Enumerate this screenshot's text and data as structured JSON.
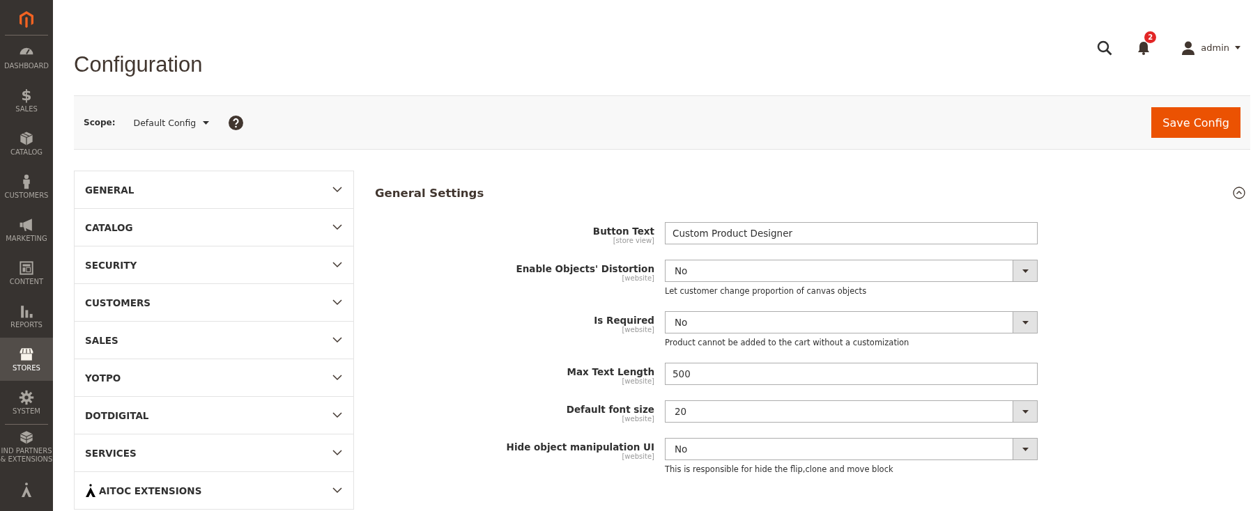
{
  "sidebar": {
    "items": [
      {
        "label": "DASHBOARD",
        "kind": "gauge",
        "selected": false
      },
      {
        "label": "SALES",
        "kind": "glyph",
        "glyph": "$",
        "selected": false
      },
      {
        "label": "CATALOG",
        "kind": "box",
        "selected": false
      },
      {
        "label": "CUSTOMERS",
        "kind": "person",
        "selected": false
      },
      {
        "label": "MARKETING",
        "kind": "megaphone",
        "selected": false
      },
      {
        "label": "CONTENT",
        "kind": "layout",
        "selected": false
      },
      {
        "label": "REPORTS",
        "kind": "bars",
        "selected": false
      },
      {
        "label": "STORES",
        "kind": "store",
        "selected": true
      },
      {
        "label": "SYSTEM",
        "kind": "gear",
        "selected": false
      },
      {
        "label": "IND PARTNERS",
        "label_2": "& EXTENSIONS",
        "kind": "brick",
        "selected": false
      },
      {
        "kind": "aitoc",
        "selected": false
      }
    ]
  },
  "header": {
    "title": "Configuration",
    "notifications": "2",
    "user": "admin"
  },
  "scope_bar": {
    "label": "Scope:",
    "value": "Default Config",
    "button": "Save Config"
  },
  "nav": {
    "items": [
      {
        "label": "GENERAL",
        "kind": "plain",
        "expanded": false
      },
      {
        "label": "CATALOG",
        "kind": "plain",
        "expanded": false
      },
      {
        "label": "SECURITY",
        "kind": "plain",
        "expanded": false
      },
      {
        "label": "CUSTOMERS",
        "kind": "plain",
        "expanded": false
      },
      {
        "label": "SALES",
        "kind": "plain",
        "expanded": false
      },
      {
        "label": "YOTPO",
        "kind": "plain",
        "expanded": false
      },
      {
        "label": "DOTDIGITAL",
        "kind": "plain",
        "expanded": false
      },
      {
        "label": "SERVICES",
        "kind": "plain",
        "expanded": false
      },
      {
        "label": "AITOC EXTENSIONS",
        "kind": "branded",
        "expanded": false
      }
    ]
  },
  "section": {
    "title": "General Settings",
    "expanded": true,
    "fields": [
      {
        "label": "Button Text",
        "scope": "[store view]",
        "kind": "text",
        "value": "Custom Product Designer"
      },
      {
        "label": "Enable Objects' Distortion",
        "scope": "[website]",
        "kind": "select",
        "value": "No",
        "note": "Let customer change proportion of canvas objects"
      },
      {
        "label": "Is Required",
        "scope": "[website]",
        "kind": "select",
        "value": "No",
        "note": "Product cannot be added to the cart without a customization"
      },
      {
        "label": "Max Text Length",
        "scope": "[website]",
        "kind": "text",
        "value": "500"
      },
      {
        "label": "Default font size",
        "scope": "[website]",
        "kind": "select",
        "value": "20"
      },
      {
        "label": "Hide object manipulation UI",
        "scope": "[website]",
        "kind": "select",
        "value": "No",
        "note": "This is responsible for hide the flip,clone and move block"
      }
    ]
  }
}
